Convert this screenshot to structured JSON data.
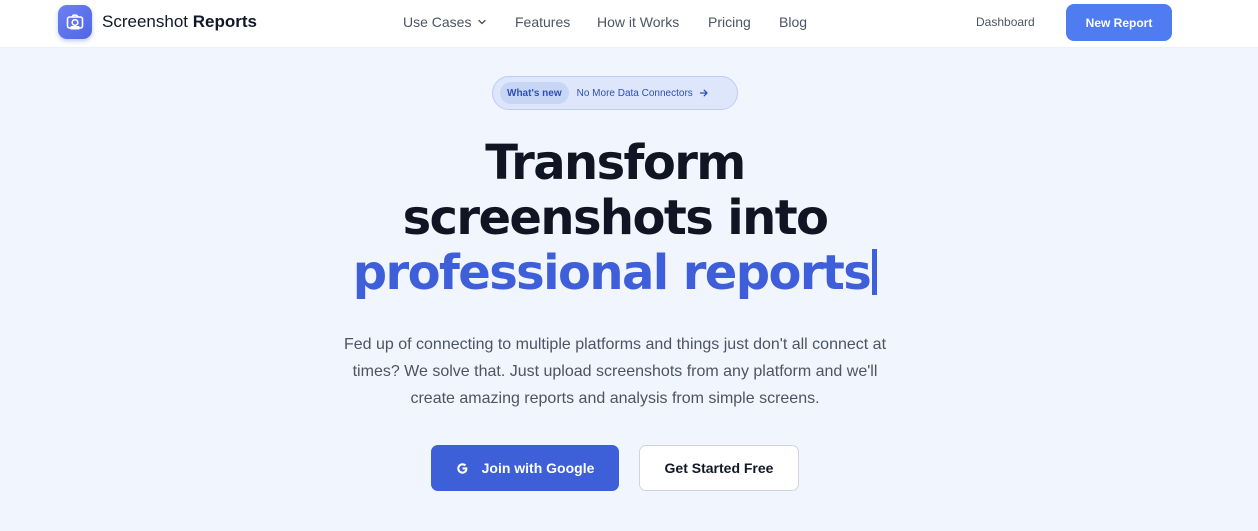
{
  "header": {
    "brand": {
      "name_regular": "Screenshot",
      "name_bold": "Reports",
      "icon": "camera-icon"
    },
    "nav": [
      {
        "label": "Use Cases",
        "has_dropdown": true
      },
      {
        "label": "Features"
      },
      {
        "label": "How it Works"
      },
      {
        "label": "Pricing"
      },
      {
        "label": "Blog"
      }
    ],
    "dashboard_label": "Dashboard",
    "new_report_label": "New Report"
  },
  "badge": {
    "tag": "What's new",
    "text": "No More Data Connectors",
    "icon": "arrow-right-icon"
  },
  "hero": {
    "title_line1": "Transform",
    "title_line2": "screenshots into",
    "title_line3": "professional reports",
    "description_lines": [
      "Fed up of connecting to multiple platforms and things just don't all connect at",
      "times? We solve that. Just upload screenshots from any platform and we'll",
      "create amazing reports and analysis from simple screens."
    ]
  },
  "cta": {
    "google_label": "Join with Google",
    "google_icon": "google-g-icon",
    "start_label": "Get Started Free"
  },
  "colors": {
    "accent": "#3e5fd9",
    "primary_button": "#4f7cf0",
    "background": "#f1f5fd"
  }
}
